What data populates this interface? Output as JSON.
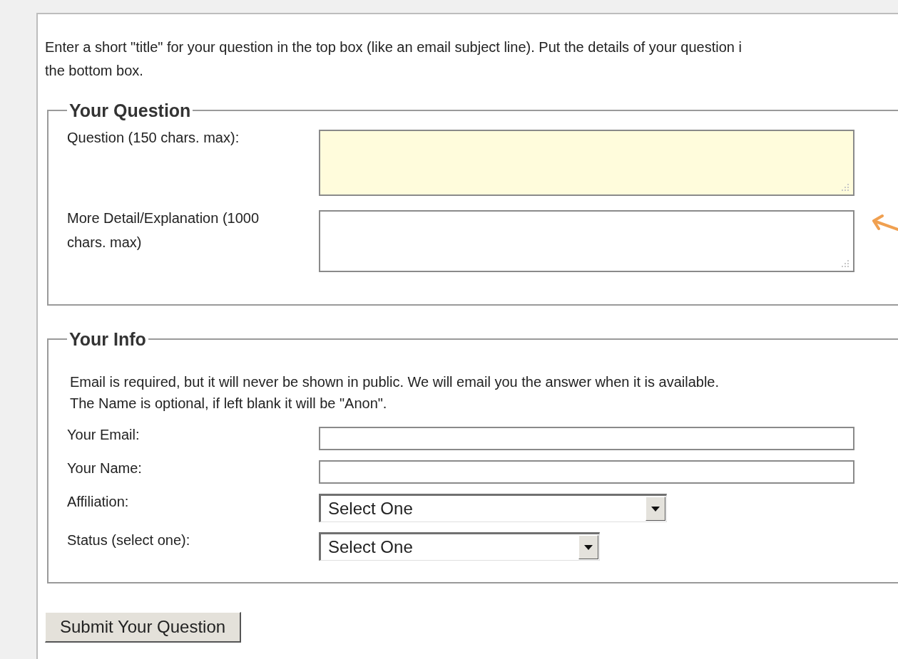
{
  "intro_lines": [
    "Enter a short \"title\" for your question in the top box (like an email subject line). Put the details of your question i",
    "the bottom box."
  ],
  "sections": [
    {
      "legend": "Your Question",
      "fields": [
        {
          "kind": "textarea",
          "label_lines": [
            "Question (150 chars. max):"
          ],
          "focused": true
        },
        {
          "kind": "textarea",
          "label_lines": [
            "More Detail/Explanation (1000",
            "chars. max)"
          ],
          "focused": false
        }
      ]
    },
    {
      "legend": "Your Info",
      "note_lines": [
        "Email is required, but it will never be shown in public. We will email you the answer when it is available.",
        "The Name is optional, if left blank it will be \"Anon\"."
      ],
      "fields": [
        {
          "kind": "text",
          "label_lines": [
            "Your Email:"
          ],
          "focused": false
        },
        {
          "kind": "text",
          "label_lines": [
            "Your Name:"
          ],
          "focused": false
        },
        {
          "kind": "select",
          "label_lines": [
            "Affiliation:"
          ],
          "value": "Select One"
        },
        {
          "kind": "select",
          "label_lines": [
            "Status (select one):"
          ],
          "value": "Select One"
        }
      ]
    }
  ],
  "submit": "Submit Your Question"
}
